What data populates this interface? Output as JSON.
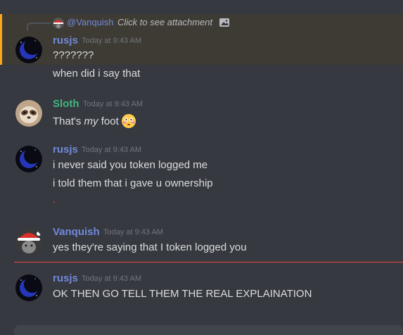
{
  "colors": {
    "background": "#36393f",
    "mention_bg": "#3e3b35",
    "mention_bar": "#faa61a",
    "text": "#dcddde",
    "timestamp": "#72767d",
    "new_messages_line": "#f04747"
  },
  "reply": {
    "name": "@Vanquish",
    "text": "Click to see attachment",
    "attachment_icon": "image-icon"
  },
  "messages": [
    {
      "author": "rusjs",
      "author_color": "#7289da",
      "timestamp": "Today at 9:43 AM",
      "lines": [
        "???????",
        "when did i say that"
      ]
    },
    {
      "author": "Sloth",
      "author_color": "#43b581",
      "timestamp": "Today at 9:43 AM",
      "text_before": "That's ",
      "text_italic": "my",
      "text_after": " foot",
      "emoji": "flushed-face-emoji"
    },
    {
      "author": "rusjs",
      "author_color": "#7289da",
      "timestamp": "Today at 9:43 AM",
      "lines": [
        "i never said you token logged me",
        "i told them that i gave u ownership",
        "."
      ]
    },
    {
      "author": "Vanquish",
      "author_color": "#7289da",
      "timestamp": "Today at 9:43 AM",
      "lines": [
        "yes they're saying that I token logged you"
      ]
    },
    {
      "author": "rusjs",
      "author_color": "#7289da",
      "timestamp": "Today at 9:43 AM",
      "lines": [
        "OK THEN GO TELL THEM THE REAL EXPLAINATION"
      ]
    }
  ]
}
